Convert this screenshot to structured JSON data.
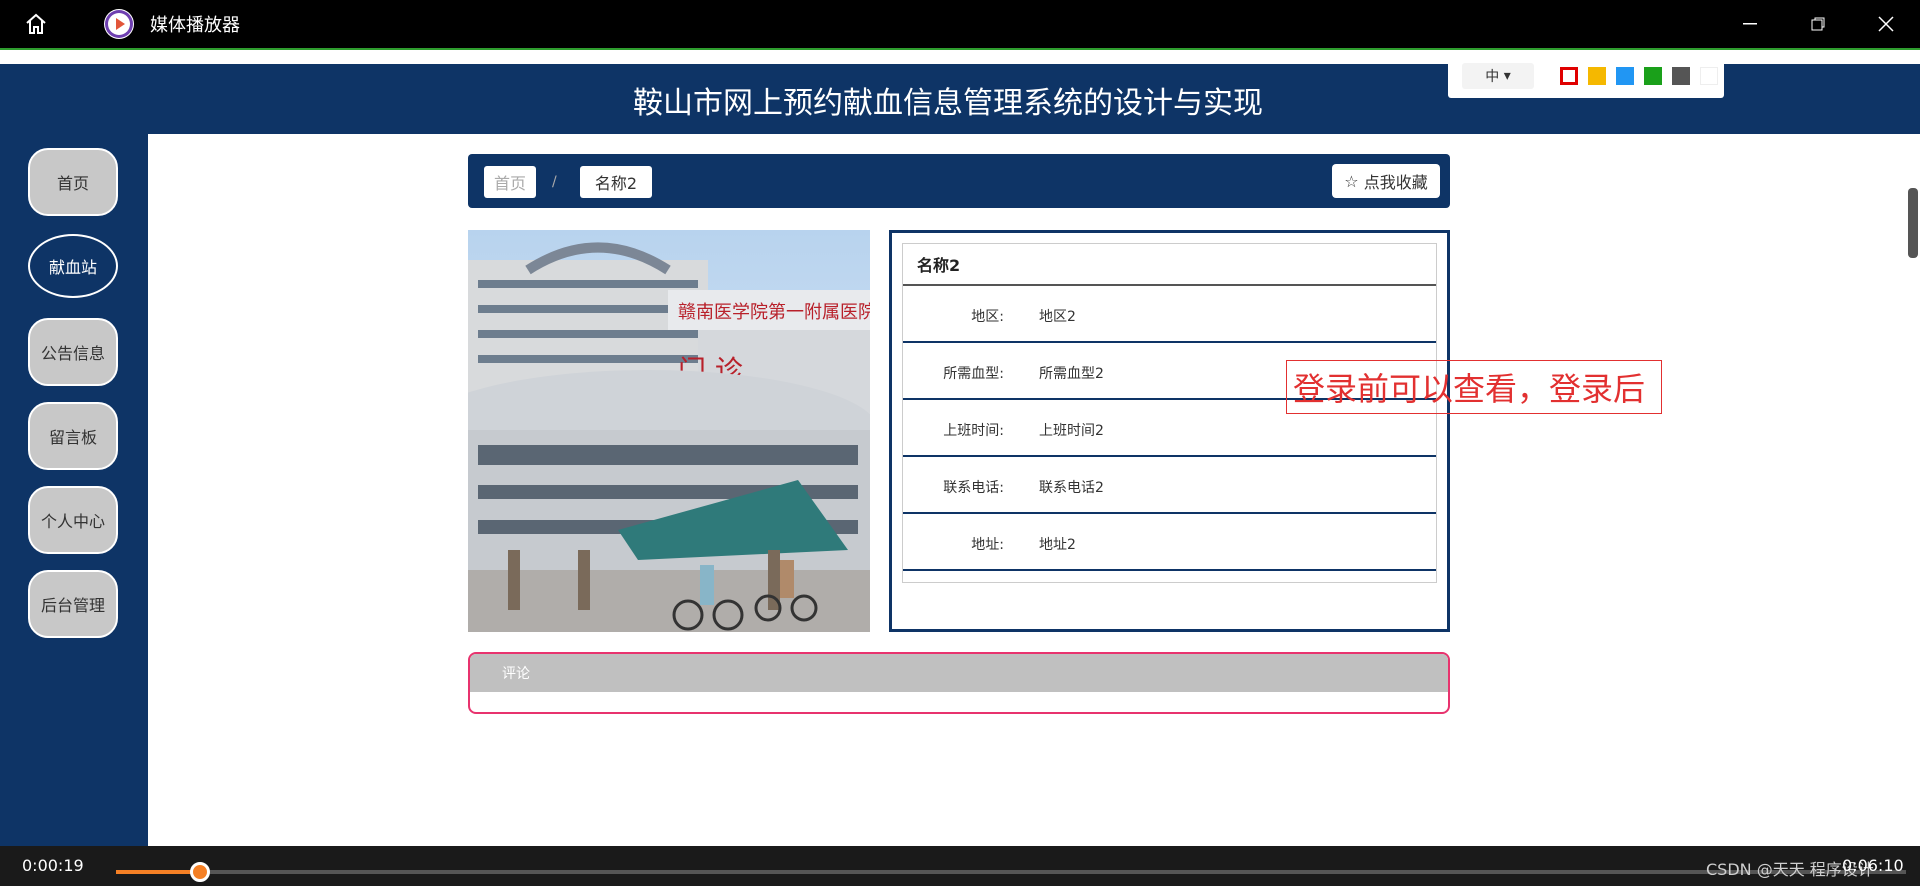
{
  "window": {
    "title": "媒体播放器",
    "home_icon": "home-icon",
    "app_icon": "play-icon"
  },
  "header": {
    "title": "鞍山市网上预约献血信息管理系统的设计与实现"
  },
  "toolbar": {
    "lang": "中",
    "swatches": [
      "#e00000",
      "#f5b800",
      "#2196f3",
      "#1aa01a",
      "#555555",
      "#ffffff"
    ]
  },
  "sidebar": {
    "items": [
      {
        "label": "首页"
      },
      {
        "label": "献血站",
        "active": true
      },
      {
        "label": "公告信息"
      },
      {
        "label": "留言板"
      },
      {
        "label": "个人中心"
      },
      {
        "label": "后台管理"
      }
    ]
  },
  "breadcrumb": {
    "home": "首页",
    "separator": "/",
    "current": "名称2"
  },
  "favorite": {
    "label": "点我收藏"
  },
  "detail": {
    "title": "名称2",
    "rows": [
      {
        "key": "地区:",
        "value": "地区2"
      },
      {
        "key": "所需血型:",
        "value": "所需血型2"
      },
      {
        "key": "上班时间:",
        "value": "上班时间2"
      },
      {
        "key": "联系电话:",
        "value": "联系电话2"
      },
      {
        "key": "地址:",
        "value": "地址2"
      }
    ]
  },
  "comment": {
    "label": "评论"
  },
  "overlay": {
    "text": "登录前可以查看，登录后"
  },
  "player": {
    "current": "0:00:19",
    "duration": "0:06:10",
    "progress": 0.047,
    "watermark": "CSDN @天天 程序设计"
  }
}
